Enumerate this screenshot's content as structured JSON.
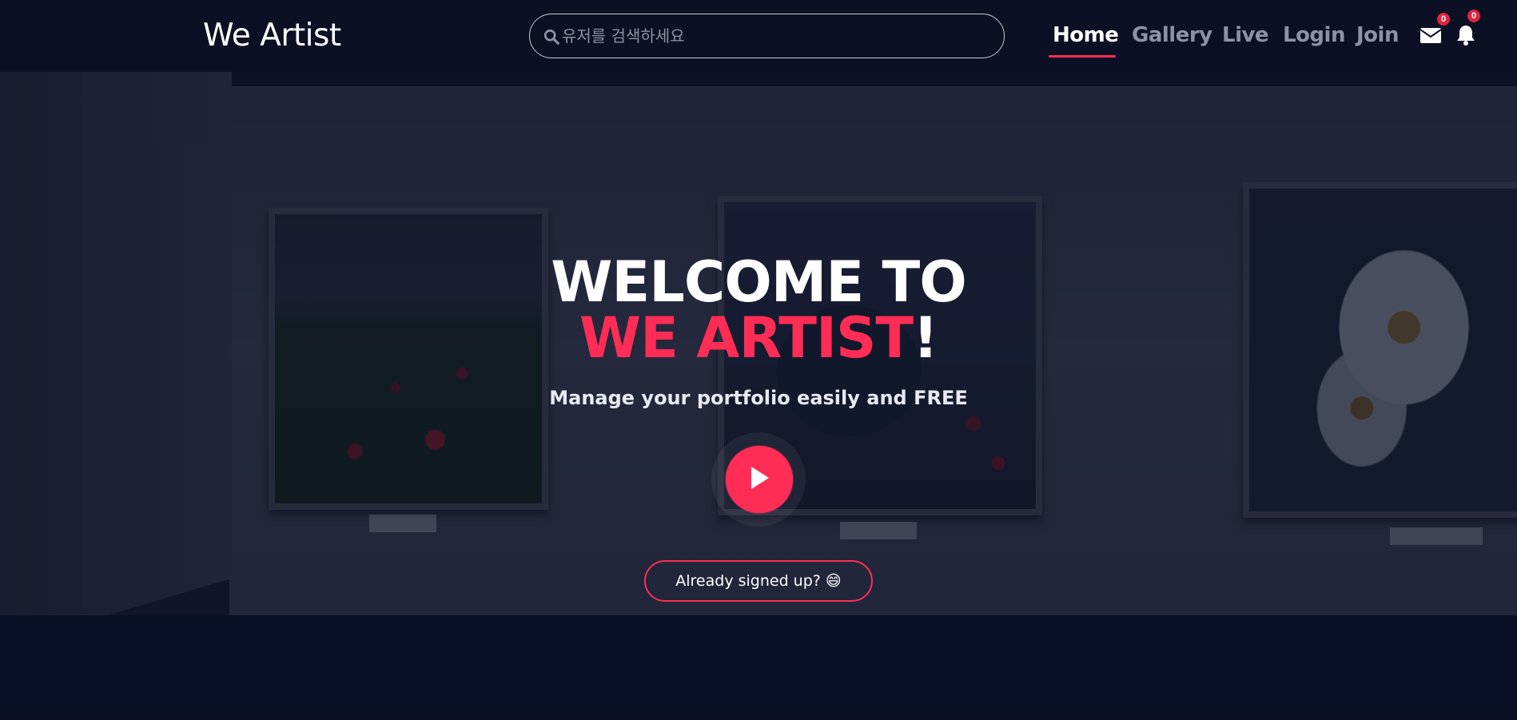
{
  "brand": {
    "name": "We Artist"
  },
  "search": {
    "placeholder": "유저를 검색하세요",
    "value": ""
  },
  "nav": {
    "items": [
      {
        "label": "Home",
        "active": true
      },
      {
        "label": "Gallery",
        "active": false
      },
      {
        "label": "Live",
        "active": false
      },
      {
        "label": "Login",
        "active": false
      },
      {
        "label": "Join",
        "active": false
      }
    ],
    "icons": {
      "messages": {
        "icon": "envelope-icon",
        "count": "0"
      },
      "notifications": {
        "icon": "bell-icon",
        "count": "0"
      }
    }
  },
  "hero": {
    "title_line1": "WELCOME TO",
    "title_accent": "WE ARTIST",
    "title_end": "!",
    "subtitle": "Manage your portfolio easily and FREE",
    "play_icon": "play-icon",
    "secondary_button": "Already signed up? 😄"
  },
  "colors": {
    "accent": "#ff2d55",
    "navbar_bg": "#0b1024",
    "nav_inactive": "#8d92a6",
    "badge": "#e0243e"
  }
}
